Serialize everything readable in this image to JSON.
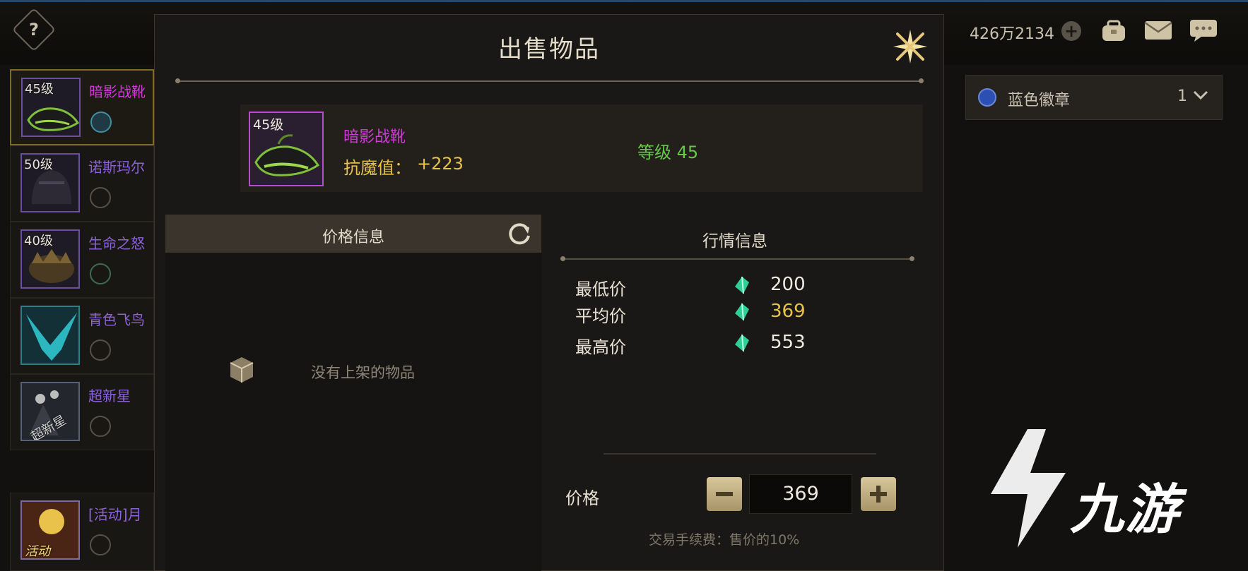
{
  "topbar": {
    "currency": "426万2134",
    "icons": [
      "help-icon",
      "add-currency-icon",
      "bag-icon",
      "mail-icon",
      "chat-icon"
    ]
  },
  "inventory": [
    {
      "level": "45级",
      "name": "暗影战靴",
      "selected": true
    },
    {
      "level": "50级",
      "name": "诺斯玛尔"
    },
    {
      "level": "40级",
      "name": "生命之怒"
    },
    {
      "level": "",
      "name": "青色飞鸟"
    },
    {
      "level": "",
      "name": "超新星",
      "thumb_text": "超新星"
    },
    {
      "level": "",
      "name": "[活动]月",
      "thumb_text": "活动"
    }
  ],
  "filter": {
    "label": "蓝色徽章",
    "count": "1"
  },
  "modal": {
    "title": "出售物品",
    "item": {
      "level": "45级",
      "name": "暗影战靴",
      "stat_label": "抗魔值：",
      "stat_value": "+223",
      "level_text": "等级 45"
    },
    "price_info": {
      "header": "价格信息",
      "empty_text": "没有上架的物品"
    },
    "market": {
      "title": "行情信息",
      "rows": [
        {
          "label": "最低价",
          "value": "200"
        },
        {
          "label": "平均价",
          "value": "369"
        },
        {
          "label": "最高价",
          "value": "553"
        }
      ]
    },
    "price": {
      "label": "价格",
      "value": "369",
      "fee_text": "交易手续费：售价的10%"
    }
  },
  "watermark": "九游",
  "colors": {
    "rare_purple": "#cf3ad6",
    "stat_gold": "#e8c24a",
    "level_green": "#66c74a",
    "button_gold": "#c9b886"
  }
}
